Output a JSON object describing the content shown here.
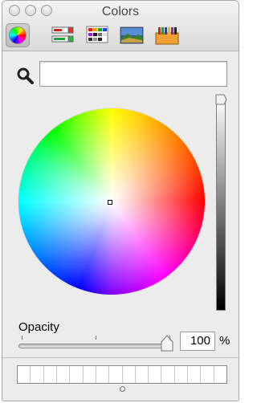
{
  "window": {
    "title": "Colors"
  },
  "toolbar": {
    "modes": [
      {
        "name": "color-wheel-mode",
        "icon": "color-wheel-icon",
        "selected": true
      },
      {
        "name": "color-sliders-mode",
        "icon": "sliders-icon",
        "selected": false
      },
      {
        "name": "color-palettes-mode",
        "icon": "palettes-icon",
        "selected": false
      },
      {
        "name": "image-palettes-mode",
        "icon": "image-icon",
        "selected": false
      },
      {
        "name": "crayons-mode",
        "icon": "crayons-icon",
        "selected": false
      }
    ]
  },
  "search": {
    "value": "",
    "placeholder": ""
  },
  "brightness": {
    "level": 1.0
  },
  "opacity": {
    "label": "Opacity",
    "value": "100",
    "unit": "%",
    "level": 1.0
  },
  "swatches": {
    "count": 16
  },
  "colors": {
    "window_bg": "#ececec",
    "selected_color": "#ffffff"
  }
}
